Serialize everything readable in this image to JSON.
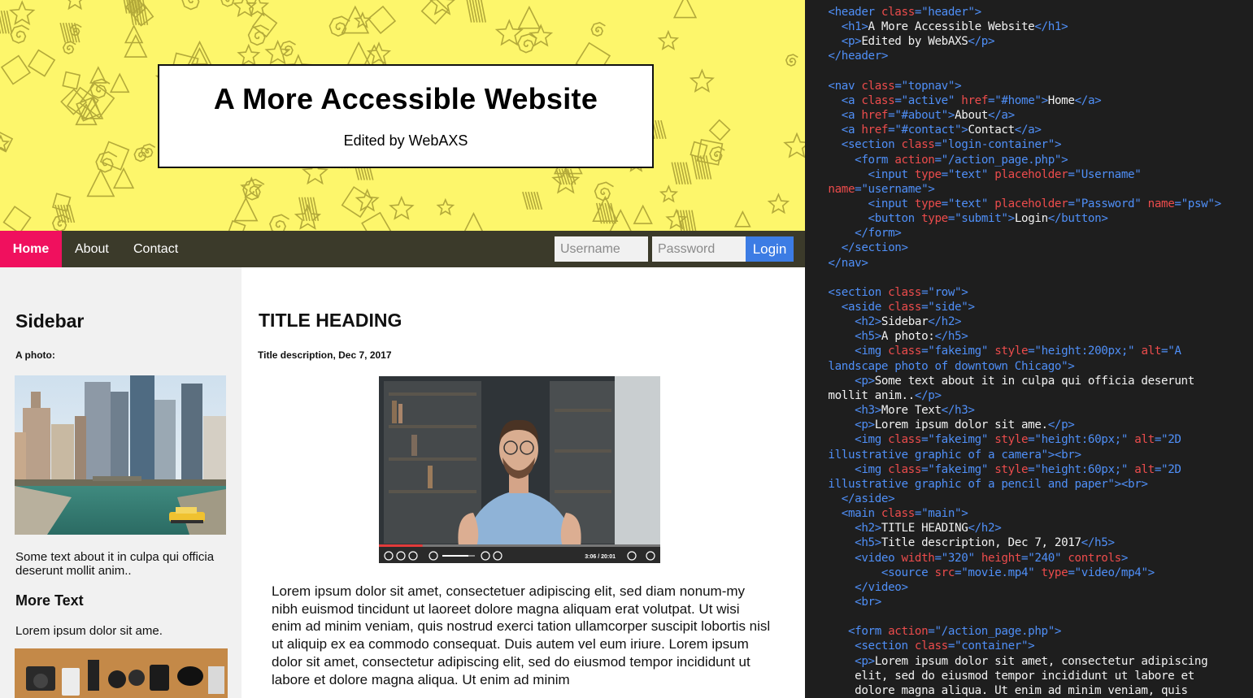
{
  "header": {
    "title": "A More Accessible Website",
    "subtitle": "Edited by WebAXS",
    "background_color": "#fdf66b"
  },
  "nav": {
    "items": [
      {
        "label": "Home",
        "active": true
      },
      {
        "label": "About",
        "active": false
      },
      {
        "label": "Contact",
        "active": false
      }
    ],
    "login": {
      "username_placeholder": "Username",
      "password_placeholder": "Password",
      "button_label": "Login"
    },
    "active_color": "#f0105e",
    "bar_color": "#3b3a2a"
  },
  "sidebar": {
    "heading": "Sidebar",
    "photo_label": "A photo:",
    "photo_text": "Some text about it in culpa qui officia deserunt mollit anim..",
    "more_heading": "More Text",
    "more_text": "Lorem ipsum dolor sit ame."
  },
  "main": {
    "heading": "TITLE HEADING",
    "description": "Title description, Dec 7, 2017",
    "video": {
      "time": "3:06 / 20:01",
      "progress": 0.155,
      "volume": 0.8
    },
    "body": "Lorem ipsum dolor sit amet, consectetuer adipiscing elit, sed diam nonum-my nibh euismod tincidunt ut laoreet dolore magna aliquam erat volutpat. Ut wisi enim ad minim veniam, quis nostrud exerci tation ullamcorper suscipit lobortis nisl ut aliquip ex ea commodo consequat. Duis autem vel eum iriure. Lorem ipsum dolor sit amet, consectetur adipiscing elit, sed do eiusmod tempor incididunt ut labore et dolore magna aliqua. Ut enim ad minim"
  },
  "code": {
    "lines": [
      [
        [
          "t",
          "  <header "
        ],
        [
          "a",
          "class"
        ],
        [
          "t",
          "="
        ],
        [
          "s",
          "\"header\""
        ],
        [
          "t",
          ">"
        ]
      ],
      [
        [
          "t",
          "    <h1>"
        ],
        [
          "x",
          "A More Accessible Website"
        ],
        [
          "t",
          "</h1>"
        ]
      ],
      [
        [
          "t",
          "    <p>"
        ],
        [
          "x",
          "Edited by WebAXS"
        ],
        [
          "t",
          "</p>"
        ]
      ],
      [
        [
          "t",
          "  </header>"
        ]
      ],
      [],
      [
        [
          "t",
          "  <nav "
        ],
        [
          "a",
          "class"
        ],
        [
          "t",
          "="
        ],
        [
          "s",
          "\"topnav\""
        ],
        [
          "t",
          ">"
        ]
      ],
      [
        [
          "t",
          "    <a "
        ],
        [
          "a",
          "class"
        ],
        [
          "t",
          "="
        ],
        [
          "s",
          "\"active\" "
        ],
        [
          "a",
          "href"
        ],
        [
          "t",
          "="
        ],
        [
          "s",
          "\"#home\""
        ],
        [
          "t",
          ">"
        ],
        [
          "x",
          "Home"
        ],
        [
          "t",
          "</a>"
        ]
      ],
      [
        [
          "t",
          "    <a "
        ],
        [
          "a",
          "href"
        ],
        [
          "t",
          "="
        ],
        [
          "s",
          "\"#about\""
        ],
        [
          "t",
          ">"
        ],
        [
          "x",
          "About"
        ],
        [
          "t",
          "</a>"
        ]
      ],
      [
        [
          "t",
          "    <a "
        ],
        [
          "a",
          "href"
        ],
        [
          "t",
          "="
        ],
        [
          "s",
          "\"#contact\""
        ],
        [
          "t",
          ">"
        ],
        [
          "x",
          "Contact"
        ],
        [
          "t",
          "</a>"
        ]
      ],
      [
        [
          "t",
          "    <section "
        ],
        [
          "a",
          "class"
        ],
        [
          "t",
          "="
        ],
        [
          "s",
          "\"login-container\""
        ],
        [
          "t",
          ">"
        ]
      ],
      [
        [
          "t",
          "      <form "
        ],
        [
          "a",
          "action"
        ],
        [
          "t",
          "="
        ],
        [
          "s",
          "\"/action_page.php\""
        ],
        [
          "t",
          ">"
        ]
      ],
      [
        [
          "t",
          "        <input "
        ],
        [
          "a",
          "type"
        ],
        [
          "t",
          "="
        ],
        [
          "s",
          "\"text\" "
        ],
        [
          "a",
          "placeholder"
        ],
        [
          "t",
          "="
        ],
        [
          "s",
          "\"Username\""
        ]
      ],
      [
        [
          "a",
          "  name"
        ],
        [
          "t",
          "="
        ],
        [
          "s",
          "\"username\""
        ],
        [
          "t",
          ">"
        ]
      ],
      [
        [
          "t",
          "        <input "
        ],
        [
          "a",
          "type"
        ],
        [
          "t",
          "="
        ],
        [
          "s",
          "\"text\" "
        ],
        [
          "a",
          "placeholder"
        ],
        [
          "t",
          "="
        ],
        [
          "s",
          "\"Password\" "
        ],
        [
          "a",
          "name"
        ],
        [
          "t",
          "="
        ],
        [
          "s",
          "\"psw\""
        ],
        [
          "t",
          ">"
        ]
      ],
      [
        [
          "t",
          "        <button "
        ],
        [
          "a",
          "type"
        ],
        [
          "t",
          "="
        ],
        [
          "s",
          "\"submit\""
        ],
        [
          "t",
          ">"
        ],
        [
          "x",
          "Login"
        ],
        [
          "t",
          "</button>"
        ]
      ],
      [
        [
          "t",
          "      </form>"
        ]
      ],
      [
        [
          "t",
          "    </section>"
        ]
      ],
      [
        [
          "t",
          "  </nav>"
        ]
      ],
      [],
      [
        [
          "t",
          "  <section "
        ],
        [
          "a",
          "class"
        ],
        [
          "t",
          "="
        ],
        [
          "s",
          "\"row\""
        ],
        [
          "t",
          ">"
        ]
      ],
      [
        [
          "t",
          "    <aside "
        ],
        [
          "a",
          "class"
        ],
        [
          "t",
          "="
        ],
        [
          "s",
          "\"side\""
        ],
        [
          "t",
          ">"
        ]
      ],
      [
        [
          "t",
          "      <h2>"
        ],
        [
          "x",
          "Sidebar"
        ],
        [
          "t",
          "</h2>"
        ]
      ],
      [
        [
          "t",
          "      <h5>"
        ],
        [
          "x",
          "A photo:"
        ],
        [
          "t",
          "</h5>"
        ]
      ],
      [
        [
          "t",
          "      <img "
        ],
        [
          "a",
          "class"
        ],
        [
          "t",
          "="
        ],
        [
          "s",
          "\"fakeimg\" "
        ],
        [
          "a",
          "style"
        ],
        [
          "t",
          "="
        ],
        [
          "s",
          "\"height:200px;\" "
        ],
        [
          "a",
          "alt"
        ],
        [
          "t",
          "="
        ],
        [
          "s",
          "\"A"
        ]
      ],
      [
        [
          "s",
          "  landscape photo of downtown Chicago\""
        ],
        [
          "t",
          ">"
        ]
      ],
      [
        [
          "t",
          "      <p>"
        ],
        [
          "x",
          "Some text about it in culpa qui officia deserunt"
        ]
      ],
      [
        [
          "x",
          "  mollit anim.."
        ],
        [
          "t",
          "</p>"
        ]
      ],
      [
        [
          "t",
          "      <h3>"
        ],
        [
          "x",
          "More Text"
        ],
        [
          "t",
          "</h3>"
        ]
      ],
      [
        [
          "t",
          "      <p>"
        ],
        [
          "x",
          "Lorem ipsum dolor sit ame."
        ],
        [
          "t",
          "</p>"
        ]
      ],
      [
        [
          "t",
          "      <img "
        ],
        [
          "a",
          "class"
        ],
        [
          "t",
          "="
        ],
        [
          "s",
          "\"fakeimg\" "
        ],
        [
          "a",
          "style"
        ],
        [
          "t",
          "="
        ],
        [
          "s",
          "\"height:60px;\" "
        ],
        [
          "a",
          "alt"
        ],
        [
          "t",
          "="
        ],
        [
          "s",
          "\"2D"
        ]
      ],
      [
        [
          "s",
          "  illustrative graphic of a camera\""
        ],
        [
          "t",
          ">"
        ],
        [
          "t",
          "<br>"
        ]
      ],
      [
        [
          "t",
          "      <img "
        ],
        [
          "a",
          "class"
        ],
        [
          "t",
          "="
        ],
        [
          "s",
          "\"fakeimg\" "
        ],
        [
          "a",
          "style"
        ],
        [
          "t",
          "="
        ],
        [
          "s",
          "\"height:60px;\" "
        ],
        [
          "a",
          "alt"
        ],
        [
          "t",
          "="
        ],
        [
          "s",
          "\"2D"
        ]
      ],
      [
        [
          "s",
          "  illustrative graphic of a pencil and paper\""
        ],
        [
          "t",
          ">"
        ],
        [
          "t",
          "<br>"
        ]
      ],
      [
        [
          "t",
          "    </aside>"
        ]
      ],
      [
        [
          "t",
          "    <main "
        ],
        [
          "a",
          "class"
        ],
        [
          "t",
          "="
        ],
        [
          "s",
          "\"main\""
        ],
        [
          "t",
          ">"
        ]
      ],
      [
        [
          "t",
          "      <h2>"
        ],
        [
          "x",
          "TITLE HEADING"
        ],
        [
          "t",
          "</h2>"
        ]
      ],
      [
        [
          "t",
          "      <h5>"
        ],
        [
          "x",
          "Title description, Dec 7, 2017"
        ],
        [
          "t",
          "</h5>"
        ]
      ],
      [
        [
          "t",
          "      <video "
        ],
        [
          "a",
          "width"
        ],
        [
          "t",
          "="
        ],
        [
          "s",
          "\"320\" "
        ],
        [
          "a",
          "height"
        ],
        [
          "t",
          "="
        ],
        [
          "s",
          "\"240\" "
        ],
        [
          "a",
          "controls"
        ],
        [
          "t",
          ">"
        ]
      ],
      [
        [
          "t",
          "          <source "
        ],
        [
          "a",
          "src"
        ],
        [
          "t",
          "="
        ],
        [
          "s",
          "\"movie.mp4\" "
        ],
        [
          "a",
          "type"
        ],
        [
          "t",
          "="
        ],
        [
          "s",
          "\"video/mp4\""
        ],
        [
          "t",
          ">"
        ]
      ],
      [
        [
          "t",
          "      </video>"
        ]
      ],
      [
        [
          "t",
          "      <br>"
        ]
      ],
      [],
      [
        [
          "t",
          "     <form "
        ],
        [
          "a",
          "action"
        ],
        [
          "t",
          "="
        ],
        [
          "s",
          "\"/action_page.php\""
        ],
        [
          "t",
          ">"
        ]
      ],
      [
        [
          "t",
          "      <section "
        ],
        [
          "a",
          "class"
        ],
        [
          "t",
          "="
        ],
        [
          "s",
          "\"container\""
        ],
        [
          "t",
          ">"
        ]
      ],
      [
        [
          "t",
          "      <p>"
        ],
        [
          "x",
          "Lorem ipsum dolor sit amet, consectetur adipiscing"
        ]
      ],
      [
        [
          "x",
          "      elit, sed do eiusmod tempor incididunt ut labore et"
        ]
      ],
      [
        [
          "x",
          "      dolore magna aliqua. Ut enim ad minim veniam, quis"
        ]
      ]
    ]
  }
}
